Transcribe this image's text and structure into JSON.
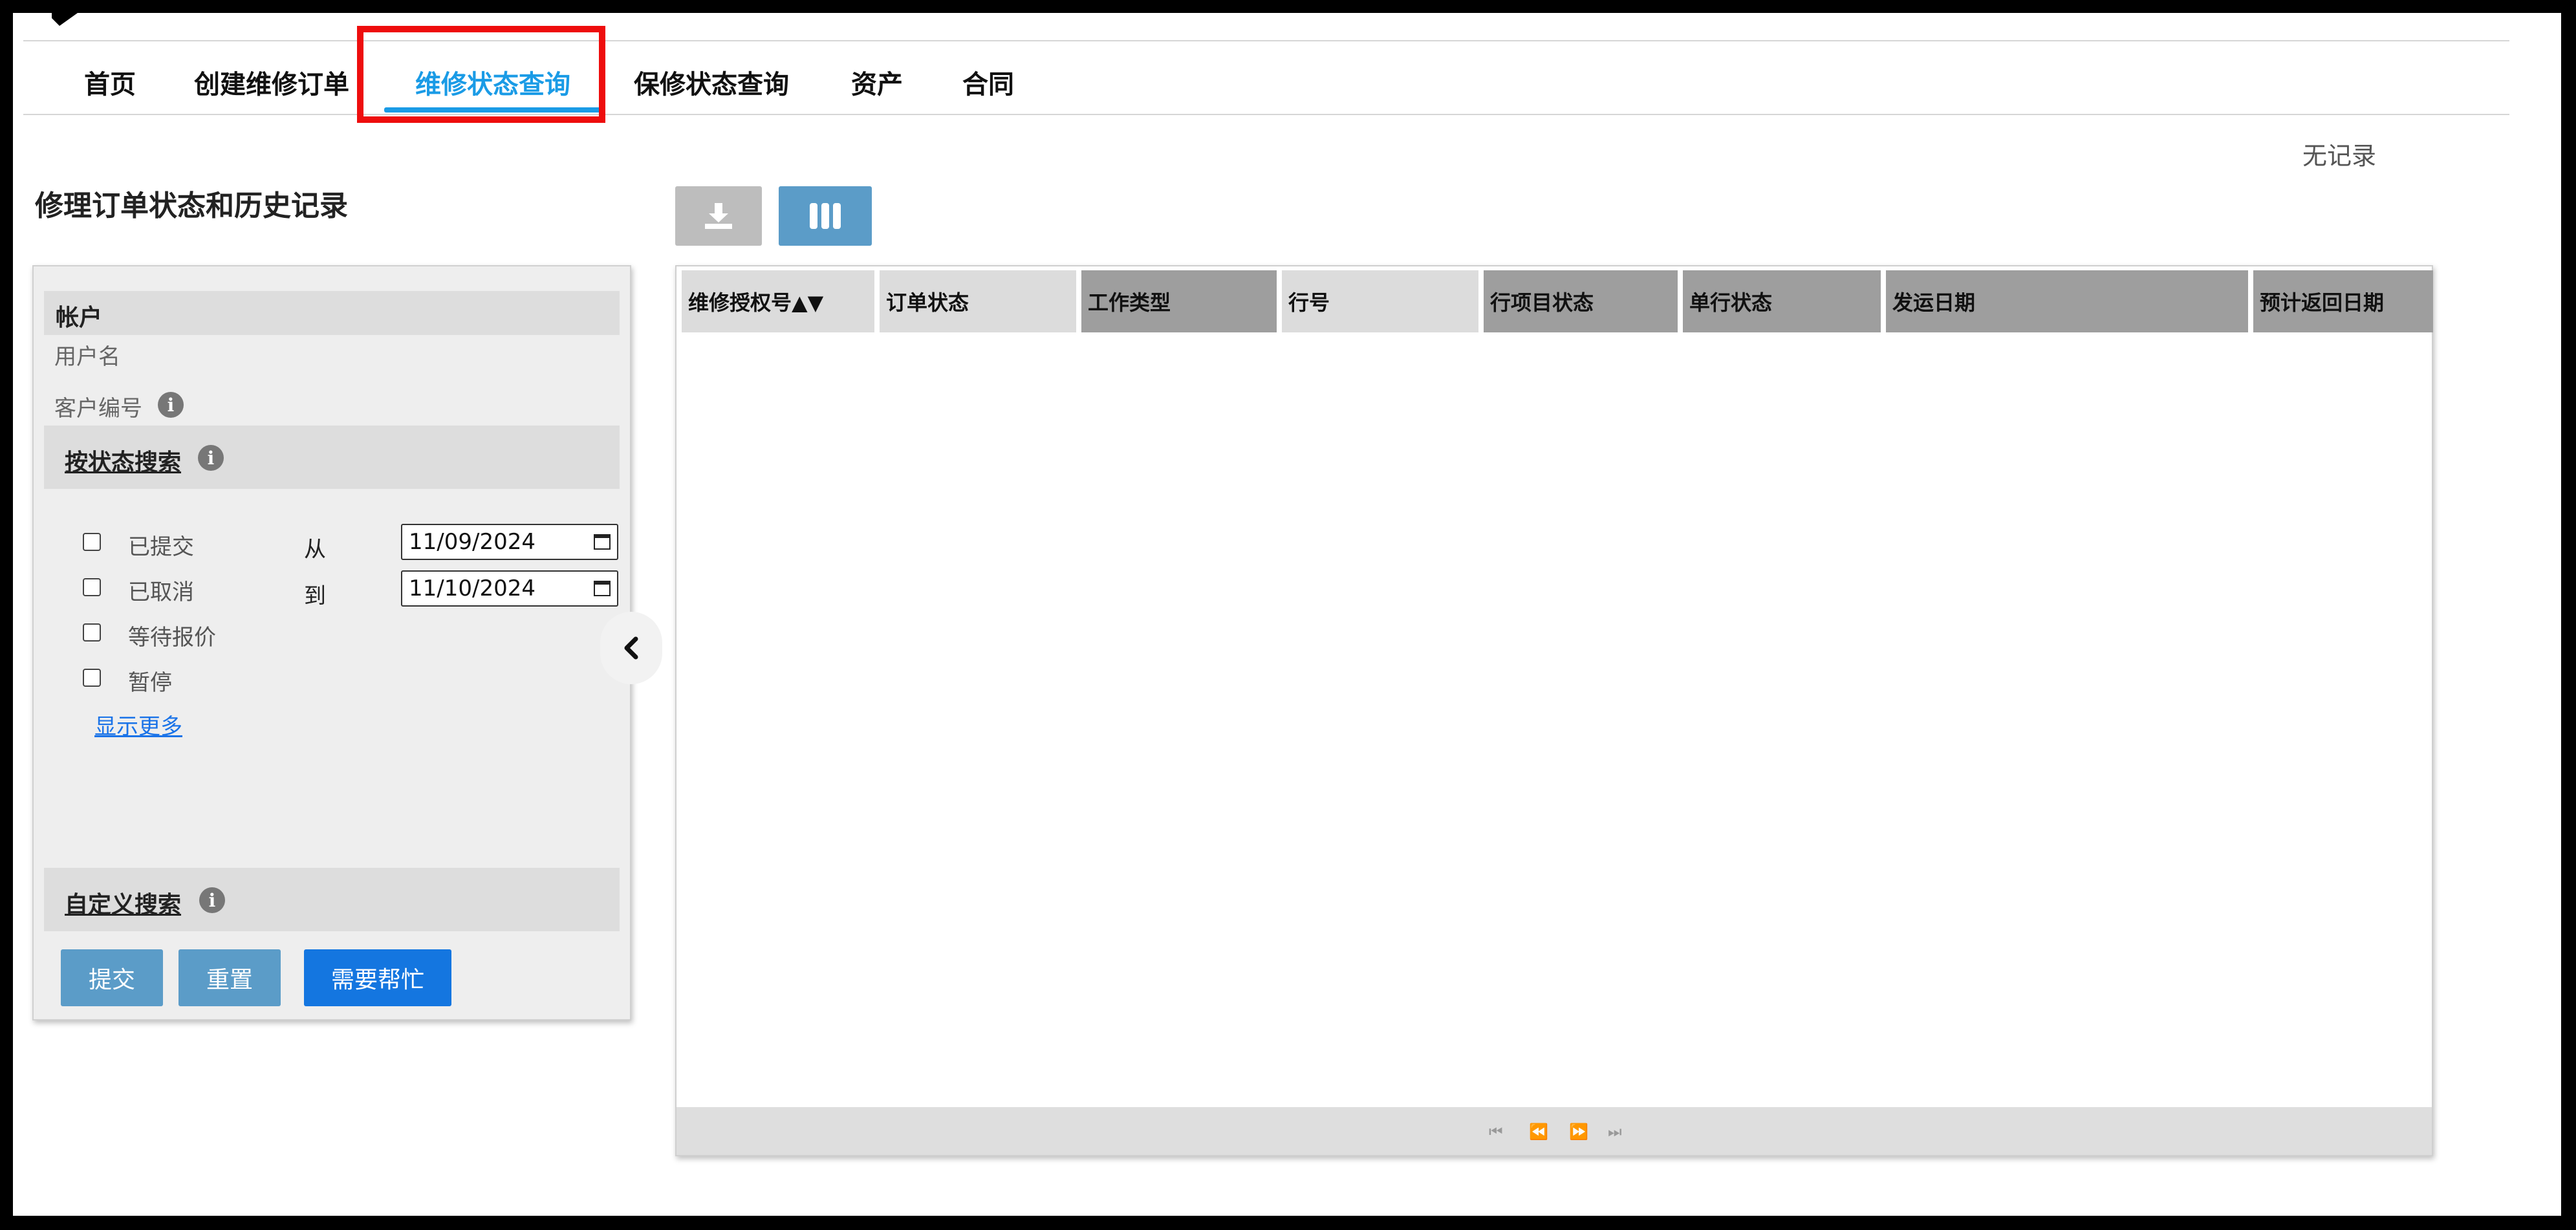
{
  "nav": {
    "tabs": [
      {
        "label": "首页"
      },
      {
        "label": "创建维修订单"
      },
      {
        "label": "维修状态查询"
      },
      {
        "label": "保修状态查询"
      },
      {
        "label": "资产"
      },
      {
        "label": "合同"
      }
    ],
    "active_tab": "维修状态查询"
  },
  "status": {
    "no_records": "无记录"
  },
  "page_title": "修理订单状态和历史记录",
  "left_panel": {
    "account_section": "帐户",
    "username_label": "用户名",
    "customer_number_label": "客户编号",
    "status_search_label": "按状态搜索",
    "statuses": [
      {
        "label": "已提交",
        "checked": false
      },
      {
        "label": "已取消",
        "checked": false
      },
      {
        "label": "等待报价",
        "checked": false
      },
      {
        "label": "暂停",
        "checked": false
      }
    ],
    "date_from_label": "从",
    "date_to_label": "到",
    "date_from_value": "11/09/2024",
    "date_to_value": "11/10/2024",
    "show_more": "显示更多",
    "custom_search_label": "自定义搜索",
    "buttons": {
      "submit": "提交",
      "reset": "重置",
      "help": "需要帮忙"
    },
    "info_glyph": "i"
  },
  "toolbar": {
    "download_icon": "download-icon",
    "columns_icon": "columns-icon"
  },
  "grid": {
    "columns": [
      {
        "label": "维修授权号▲▼"
      },
      {
        "label": "订单状态"
      },
      {
        "label": "工作类型"
      },
      {
        "label": "行号"
      },
      {
        "label": "行项目状态"
      },
      {
        "label": "单行状态"
      },
      {
        "label": "发运日期"
      },
      {
        "label": "预计返回日期"
      }
    ],
    "pager_icons": [
      "⏮",
      "⏪",
      "⏩",
      "⏭"
    ]
  },
  "colors": {
    "accent": "#1a9be6",
    "highlight": "#ee0d0d",
    "button_steel": "#5b9cc8",
    "button_blue": "#1476e0"
  }
}
